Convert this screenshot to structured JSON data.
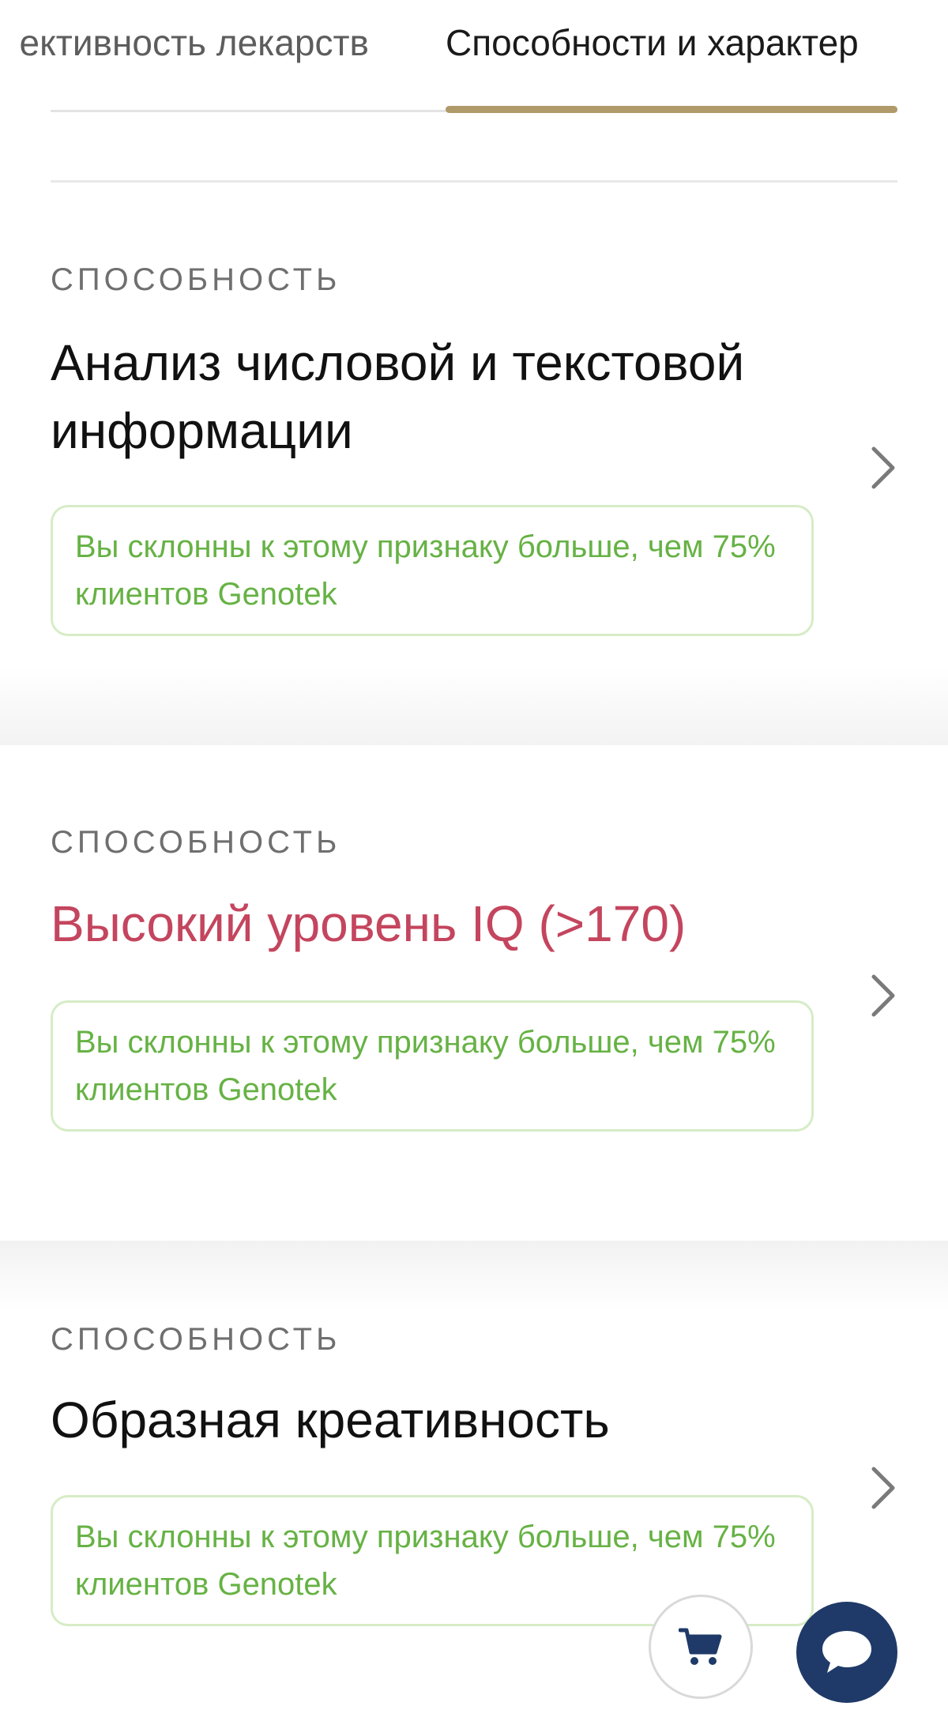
{
  "tabs": {
    "items": [
      {
        "label": "ективность лекарств",
        "active": false
      },
      {
        "label": "Способности и характер",
        "active": true
      }
    ],
    "active_indicator_color": "#b09a6a"
  },
  "cards": [
    {
      "category": "СПОСОБНОСТЬ",
      "title": "Анализ числовой и текстовой информации",
      "title_color": "#111111",
      "note": "Вы склонны к этому признаку больше, чем 75% клиентов Genotek",
      "chevron_icon": "chevron-right-icon"
    },
    {
      "category": "СПОСОБНОСТЬ",
      "title": "Высокий уровень IQ (>170)",
      "title_color": "#c4455e",
      "note": "Вы склонны к этому признаку больше, чем 75% клиентов Genotek",
      "chevron_icon": "chevron-right-icon"
    },
    {
      "category": "СПОСОБНОСТЬ",
      "title": "Образная креативность",
      "title_color": "#111111",
      "note": "Вы склонны к этому признаку больше, чем 75% клиентов Genotek",
      "chevron_icon": "chevron-right-icon"
    }
  ],
  "floating": {
    "cart_icon": "cart-icon",
    "chat_icon": "chat-bubble-icon",
    "chat_color": "#1f3a68"
  },
  "colors": {
    "note_text": "#66b244",
    "note_border": "#d6ecc6",
    "eyebrow": "#6f6f6f"
  }
}
